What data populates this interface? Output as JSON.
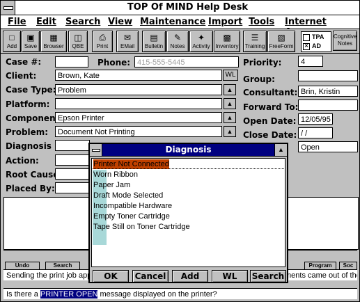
{
  "window": {
    "title": "TOP Of MIND Help Desk"
  },
  "menu": [
    "File",
    "Edit",
    "Search",
    "View",
    "Maintenance",
    "Import",
    "Tools",
    "Internet Access"
  ],
  "toolbar": {
    "buttons": [
      "Add",
      "Save",
      "Browser",
      "QBE",
      "Print",
      "EMail",
      "Bulletin",
      "Notes",
      "Activity",
      "Inventory",
      "Training",
      "FreeForm"
    ],
    "checks": [
      {
        "label": "TPA",
        "checked": false
      },
      {
        "label": "AD",
        "checked": true
      }
    ],
    "cognitive_notes": "Cognitive Notes"
  },
  "form": {
    "case_no_label": "Case #:",
    "case_no": "",
    "phone_label": "Phone:",
    "phone_placeholder": "415-555-5445",
    "client_label": "Client:",
    "client": "Brown, Kate",
    "client_wl": "WL",
    "case_type_label": "Case Type:",
    "case_type": "Problem",
    "platform_label": "Platform:",
    "platform": "",
    "component_label": "Component:",
    "component": "Epson Printer",
    "problem_label": "Problem:",
    "problem": "Document Not Printing",
    "diagnosis_label": "Diagnosis",
    "action_label": "Action:",
    "root_cause_label": "Root Cause:",
    "placed_by_label": "Placed By:",
    "priority_label": "Priority:",
    "priority": "4",
    "group_label": "Group:",
    "group": "",
    "consultant_label": "Consultant:",
    "consultant": "Brin, Kristin",
    "forward_to_label": "Forward To:",
    "forward_to": "",
    "open_date_label": "Open Date:",
    "open_date": "12/05/95",
    "close_date_label": "Close Date:",
    "close_date": " /  /",
    "status": "Open"
  },
  "strip": {
    "buttons": [
      "Undo",
      "Search",
      "Program",
      "Soc"
    ]
  },
  "messages": {
    "line1_a": "Sending the print job app",
    "line1_b": "ments came out of the",
    "line2_pre": "Is there a ",
    "line2_hl": "PRINTER OPEN",
    "line2_post": " message displayed on the printer?"
  },
  "dialog": {
    "title": "Diagnosis",
    "items": [
      "Printer Not Connected",
      "Worn Ribbon",
      "Paper Jam",
      "Draft Mode Selected",
      "Incompatible Hardware",
      "Empty Toner Cartridge",
      "Tape Still on Toner Cartridge"
    ],
    "buttons": [
      "OK",
      "Cancel",
      "Add",
      "WL",
      "Search"
    ]
  }
}
